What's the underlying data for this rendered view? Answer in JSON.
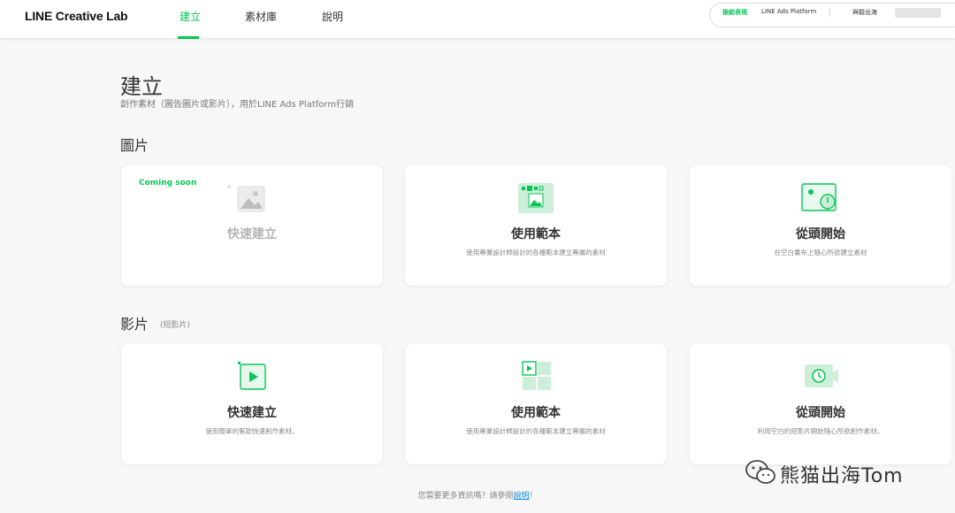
{
  "header": {
    "brand": "LINE Creative Lab",
    "nav": [
      {
        "label": "建立",
        "active": true
      },
      {
        "label": "素材庫",
        "active": false
      },
      {
        "label": "說明",
        "active": false
      }
    ],
    "account": {
      "link1": "後給表現",
      "link2": "LINE Ads Platform",
      "link3": "與驗出海"
    }
  },
  "page": {
    "title": "建立",
    "subtitle": "創作素材（圖告圖片或影片），用於LINE Ads Platform行銷"
  },
  "sections": {
    "images": {
      "title": "圖片",
      "cards": [
        {
          "title": "快速建立",
          "badge": "Coming soon",
          "desc": "",
          "icon": "image-icon",
          "disabled": true
        },
        {
          "title": "使用範本",
          "desc": "使用專業設計師設計的各種範本建立專屬的素材",
          "icon": "template-icon"
        },
        {
          "title": "從頭開始",
          "desc": "在空白畫布上隨心所欲建立素材",
          "icon": "blank-canvas-icon"
        }
      ]
    },
    "videos": {
      "title": "影片",
      "note": "(短影片)",
      "cards": [
        {
          "title": "快速建立",
          "desc": "使用簡單的幫助快速創作素材。",
          "icon": "video-play-icon"
        },
        {
          "title": "使用範本",
          "desc": "使用專業設計師設計的各種範本建立專屬的素材",
          "icon": "video-template-icon"
        },
        {
          "title": "從頭開始",
          "desc": "利用空白的短影片開始隨心所欲創作素材。",
          "icon": "video-camera-icon"
        }
      ]
    }
  },
  "footer": {
    "text": "您需要更多資訊嗎？請參閱",
    "link": "說明",
    "end": "！"
  },
  "watermark": "熊猫出海Tom",
  "colors": {
    "accent": "#06c755",
    "link": "#0a8de0"
  }
}
